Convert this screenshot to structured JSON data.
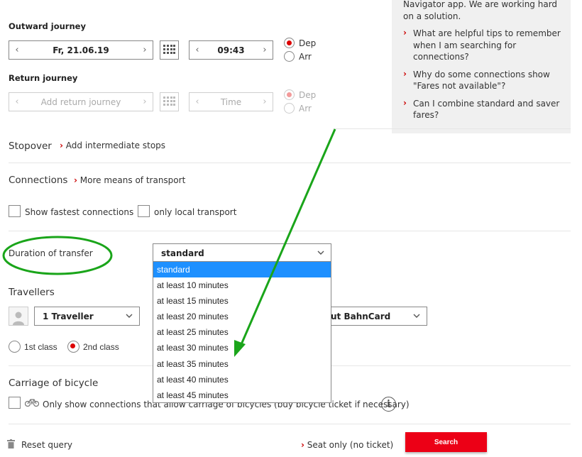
{
  "outward": {
    "title": "Outward journey",
    "date": "Fr, 21.06.19",
    "time": "09:43",
    "dep": "Dep",
    "arr": "Arr"
  },
  "return": {
    "title": "Return journey",
    "placeholder": "Add return journey",
    "time_placeholder": "Time",
    "dep": "Dep",
    "arr": "Arr"
  },
  "faq": {
    "intro": "Navigator app. We are working hard on a solution.",
    "questions": [
      "What are helpful tips to remember when I am searching for connections?",
      "Why do some connections show \"Fares not available\"?",
      "Can I combine standard and saver fares?"
    ]
  },
  "stopover": {
    "label": "Stopover",
    "link": "Add intermediate stops"
  },
  "connections": {
    "label": "Connections",
    "link": "More means of transport",
    "fastest": "Show fastest connections",
    "local": "only local transport"
  },
  "transfer": {
    "label": "Duration of transfer",
    "selected": "standard",
    "options": [
      "standard",
      "at least 10 minutes",
      "at least 15 minutes",
      "at least 20 minutes",
      "at least 25 minutes",
      "at least 30 minutes",
      "at least 35 minutes",
      "at least 40 minutes",
      "at least 45 minutes"
    ]
  },
  "travellers": {
    "label": "Travellers",
    "count": "1 Traveller",
    "bahncard": "ut BahnCard",
    "first_class": "1st class",
    "second_class": "2nd class"
  },
  "bicycle": {
    "label": "Carriage of bicycle",
    "option": "Only show connections that allow carriage of bicycles (buy bicycle ticket if necessary)"
  },
  "footer": {
    "reset": "Reset query",
    "seat_only": "Seat only (no ticket)",
    "search": "Search"
  },
  "colors": {
    "accent_red": "#ec0016",
    "annotation_green": "#1aa51a",
    "dropdown_highlight": "#1e90ff"
  }
}
